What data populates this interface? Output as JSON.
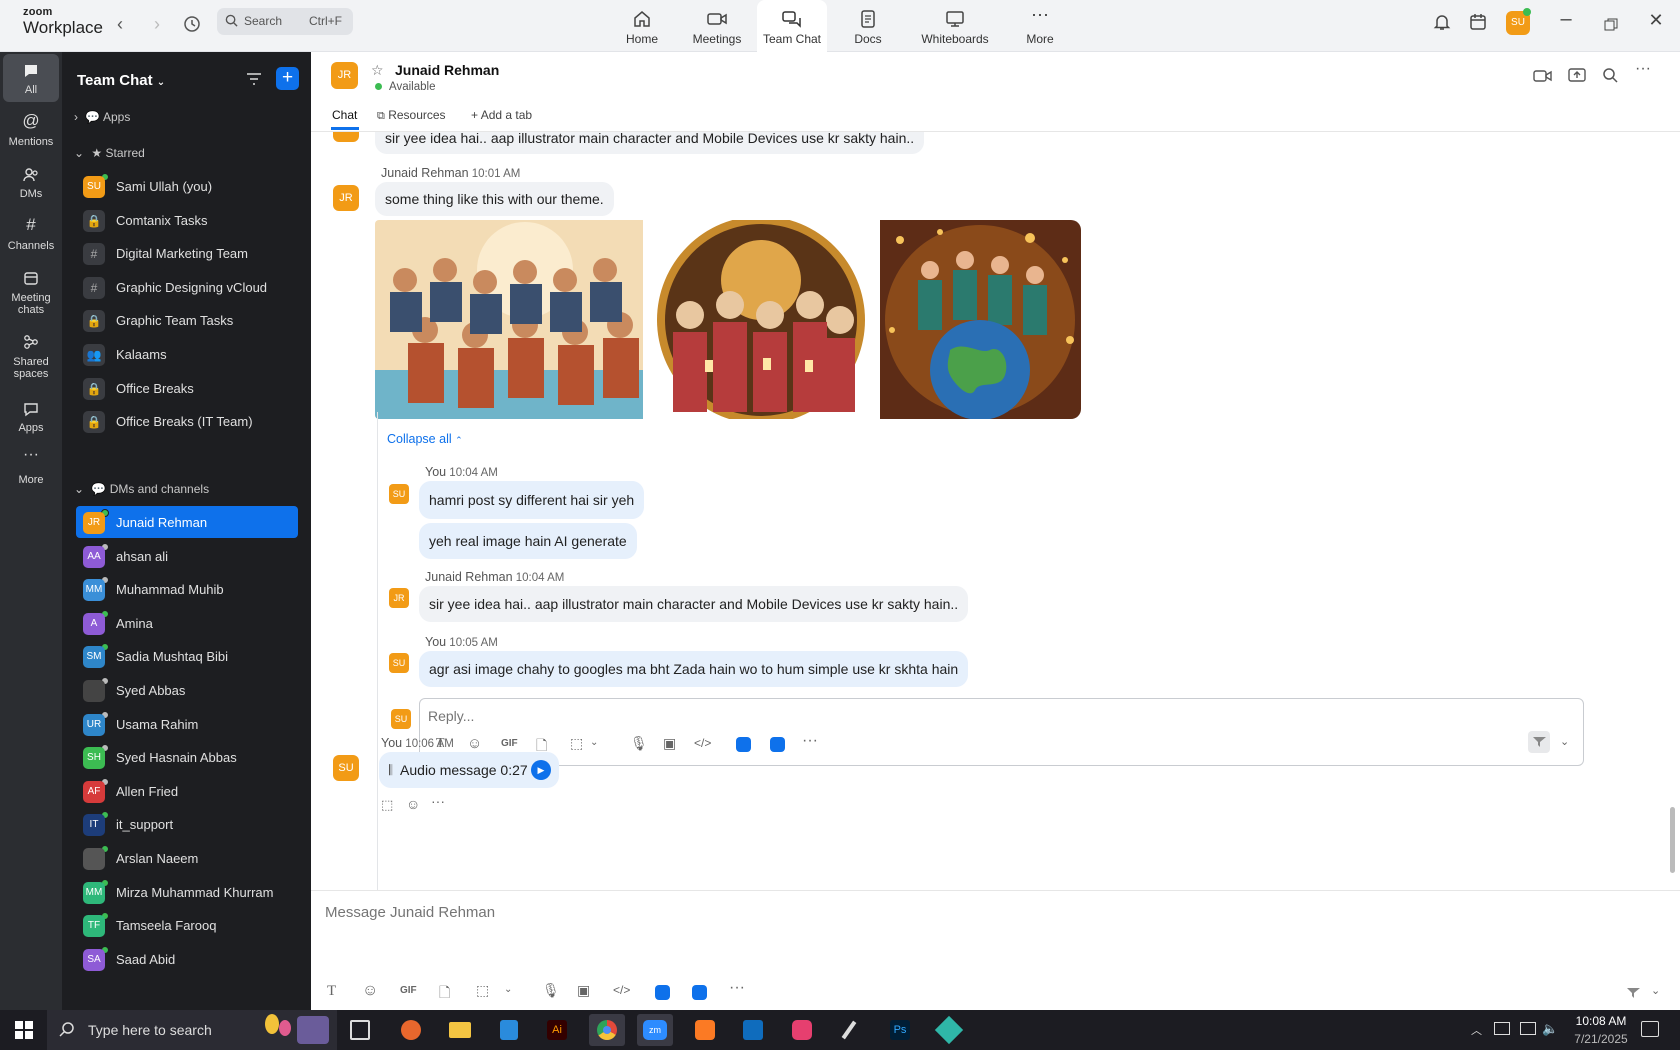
{
  "app": {
    "brand_top": "zoom",
    "brand_bottom": "Workplace"
  },
  "search": {
    "label": "Search",
    "shortcut": "Ctrl+F"
  },
  "top_tabs": [
    {
      "label": "Home",
      "icon": "home-icon"
    },
    {
      "label": "Meetings",
      "icon": "video-camera-icon"
    },
    {
      "label": "Team Chat",
      "icon": "chat-bubbles-icon",
      "active": true
    },
    {
      "label": "Docs",
      "icon": "document-icon"
    },
    {
      "label": "Whiteboards",
      "icon": "whiteboard-icon"
    },
    {
      "label": "More",
      "icon": "more-dots-icon"
    }
  ],
  "profile_initials": "SU",
  "rail": [
    {
      "label": "All",
      "icon": "chat-icon"
    },
    {
      "label": "Mentions",
      "icon": "at-icon"
    },
    {
      "label": "DMs",
      "icon": "people-icon"
    },
    {
      "label": "Channels",
      "icon": "hash-icon"
    },
    {
      "label": "Meeting\nchats",
      "icon": "calendar-icon"
    },
    {
      "label": "Shared\nspaces",
      "icon": "share-icon"
    },
    {
      "label": "Apps",
      "icon": "apps-icon"
    },
    {
      "label": "More",
      "icon": "more-icon"
    }
  ],
  "sidebar": {
    "title": "Team Chat",
    "apps_label": "Apps",
    "starred_label": "Starred",
    "dms_label": "DMs and channels",
    "starred": [
      {
        "name": "Sami Ullah (you)",
        "initials": "SU",
        "color": "#f29b16",
        "kind": "avatar",
        "status": "online"
      },
      {
        "name": "Comtanix Tasks",
        "kind": "lock"
      },
      {
        "name": "Digital Marketing Team",
        "kind": "hash"
      },
      {
        "name": "Graphic Designing vCloud",
        "kind": "hash"
      },
      {
        "name": "Graphic Team Tasks",
        "kind": "lock"
      },
      {
        "name": "Kalaams",
        "kind": "group"
      },
      {
        "name": "Office Breaks",
        "kind": "lock"
      },
      {
        "name": "Office Breaks (IT Team)",
        "kind": "lock"
      }
    ],
    "dms": [
      {
        "name": "Junaid Rehman",
        "initials": "JR",
        "color": "#f29b16",
        "status": "online",
        "active": true
      },
      {
        "name": "ahsan ali",
        "initials": "AA",
        "color": "#8e5bd6",
        "status": "away"
      },
      {
        "name": "Muhammad Muhib",
        "initials": "MM",
        "color": "#3a8fd8",
        "status": "away"
      },
      {
        "name": "Amina",
        "initials": "A",
        "color": "#8e5bd6",
        "status": "online"
      },
      {
        "name": "Sadia Mushtaq Bibi",
        "initials": "SM",
        "color": "#2e86c9",
        "status": "online"
      },
      {
        "name": "Syed Abbas",
        "initials": "",
        "color": "#444",
        "status": "away"
      },
      {
        "name": "Usama Rahim",
        "initials": "UR",
        "color": "#2e86c9",
        "status": "away"
      },
      {
        "name": "Syed Hasnain Abbas",
        "initials": "SH",
        "color": "#3cbc52",
        "status": "away"
      },
      {
        "name": "Allen Fried",
        "initials": "AF",
        "color": "#d63b3b",
        "status": "away"
      },
      {
        "name": "it_support",
        "initials": "IT",
        "color": "#1d3d7a",
        "status": "online"
      },
      {
        "name": "Arslan Naeem",
        "initials": "",
        "color": "#555",
        "status": "online"
      },
      {
        "name": "Mirza Muhammad Khurram",
        "initials": "MM",
        "color": "#2eb87a",
        "status": "online"
      },
      {
        "name": "Tamseela Farooq",
        "initials": "TF",
        "color": "#2eb87a",
        "status": "online"
      },
      {
        "name": "Saad Abid",
        "initials": "SA",
        "color": "#8e5bd6",
        "status": "online"
      }
    ]
  },
  "chat": {
    "contact_initials": "JR",
    "contact_name": "Junaid Rehman",
    "contact_status": "Available",
    "tabs": [
      "Chat",
      "Resources",
      "Add a tab"
    ],
    "top_cut_message": "sir yee idea hai.. aap illustrator main character and Mobile Devices use kr sakty hain..",
    "msg1": {
      "author": "Junaid Rehman",
      "time": "10:01 AM",
      "text": "some thing like this with our theme."
    },
    "collapse_label": "Collapse all",
    "thread": [
      {
        "author": "You",
        "time": "10:04 AM",
        "initials": "SU",
        "lines": [
          "hamri post sy different hai sir yeh",
          "yeh real image hain AI generate"
        ],
        "mine": true
      },
      {
        "author": "Junaid Rehman",
        "time": "10:04 AM",
        "initials": "JR",
        "lines": [
          "sir yee idea hai.. aap illustrator main character and Mobile Devices use kr sakty hain.."
        ],
        "mine": false
      },
      {
        "author": "You",
        "time": "10:05 AM",
        "initials": "SU",
        "lines": [
          "agr asi image chahy to googles ma bht Zada hain wo to hum simple use kr skhta hain"
        ],
        "mine": true
      }
    ],
    "reply_placeholder": "Reply...",
    "audio": {
      "author": "You",
      "time": "10:06 AM",
      "label": "Audio message 0:27",
      "initials": "SU"
    },
    "composer_placeholder": "Message Junaid Rehman",
    "toolbar_gif": "GIF"
  },
  "taskbar": {
    "search_placeholder": "Type here to search",
    "time": "10:08 AM",
    "date": "7/21/2025"
  }
}
